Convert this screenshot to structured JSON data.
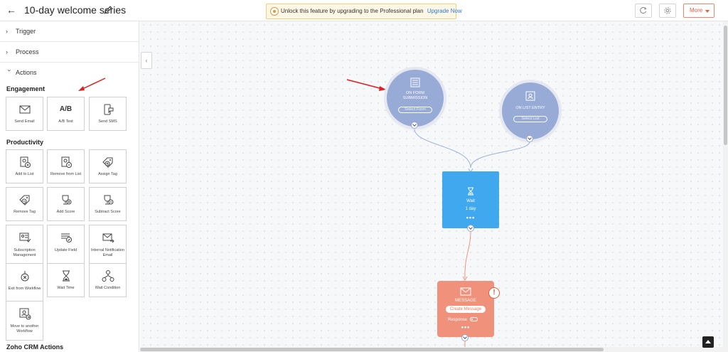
{
  "header": {
    "back_icon": "back-arrow-icon",
    "title": "10-day welcome series",
    "edit_icon": "pencil-icon",
    "banner": {
      "icon": "upgrade-badge-icon",
      "text": "Unlock this feature by upgrading to the Professional plan",
      "link": "Upgrade Now"
    },
    "refresh_icon": "refresh-icon",
    "settings_icon": "gear-icon",
    "more_label": "More"
  },
  "sidebar": {
    "sections": [
      {
        "label": "Trigger",
        "state": "collapsed"
      },
      {
        "label": "Process",
        "state": "collapsed"
      },
      {
        "label": "Actions",
        "state": "expanded"
      }
    ],
    "engagement": {
      "title": "Engagement",
      "items": [
        {
          "label": "Send Email",
          "icon": "envelope-icon"
        },
        {
          "label": "A/B Test",
          "icon": "ab-test-icon",
          "glyph": "A/B"
        },
        {
          "label": "Send SMS",
          "icon": "mobile-sms-icon"
        }
      ]
    },
    "productivity": {
      "title": "Productivity",
      "items": [
        {
          "label": "Add to List",
          "icon": "add-contact-list-icon"
        },
        {
          "label": "Remove from List",
          "icon": "remove-contact-list-icon"
        },
        {
          "label": "Assign Tag",
          "icon": "tag-add-icon"
        },
        {
          "label": "Remove Tag",
          "icon": "tag-remove-icon"
        },
        {
          "label": "Add Score",
          "icon": "trophy-add-icon"
        },
        {
          "label": "Subtract Score",
          "icon": "trophy-remove-icon"
        },
        {
          "label": "Subscription Management",
          "icon": "subscription-icon"
        },
        {
          "label": "Update Field",
          "icon": "update-field-icon"
        },
        {
          "label": "Internal Notification Email",
          "icon": "notification-email-icon"
        },
        {
          "label": "Exit from Workflow",
          "icon": "exit-workflow-icon"
        },
        {
          "label": "Wait Time",
          "icon": "hourglass-icon"
        },
        {
          "label": "Wait Condition",
          "icon": "condition-branch-icon"
        },
        {
          "label": "Move to another Workflow",
          "icon": "move-workflow-icon"
        }
      ]
    },
    "crm": {
      "title": "Zoho CRM Actions"
    }
  },
  "canvas": {
    "collapse_icon": "chevron-left-icon",
    "triggers": [
      {
        "line1": "ON FORM",
        "line2": "SUBMISSION",
        "button": "Select Form",
        "icon": "form-icon"
      },
      {
        "line1": "ON LIST ENTRY",
        "line2": "",
        "button": "Select List",
        "icon": "list-contact-icon"
      }
    ],
    "wait": {
      "title": "Wait",
      "value": "1 day",
      "icon": "hourglass-icon",
      "menu": "•••"
    },
    "message": {
      "title": "MESSAGE",
      "button": "Create Message",
      "response_label": "Response",
      "icon": "envelope-icon",
      "menu": "•••",
      "alert": "!"
    },
    "node_toggle_icon": "chevron-down-icon",
    "colors": {
      "trigger": "#97abd6",
      "wait": "#3fa8ef",
      "message": "#ef917b",
      "accent": "#e85d3c",
      "annotation_arrow": "#e02020"
    }
  }
}
